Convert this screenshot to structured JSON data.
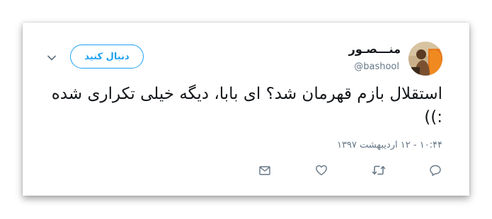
{
  "user": {
    "display_name": "منـــصـور",
    "handle": "@bashool"
  },
  "follow_button": {
    "label": "دنبال کنید"
  },
  "tweet": {
    "text": "استقلال بازم قهرمان شد؟ ای بابا، دیگه خیلی تکراری شده :))",
    "timestamp": "۱۰:۴۴ - ۱۲ اردیبهشت ۱۳۹۷"
  },
  "icons": {
    "menu": "chevron-down-icon",
    "reply": "reply-icon",
    "retweet": "retweet-icon",
    "like": "heart-icon",
    "message": "envelope-icon"
  },
  "colors": {
    "accent": "#1da1f2",
    "text": "#14171a",
    "secondary": "#657786"
  }
}
